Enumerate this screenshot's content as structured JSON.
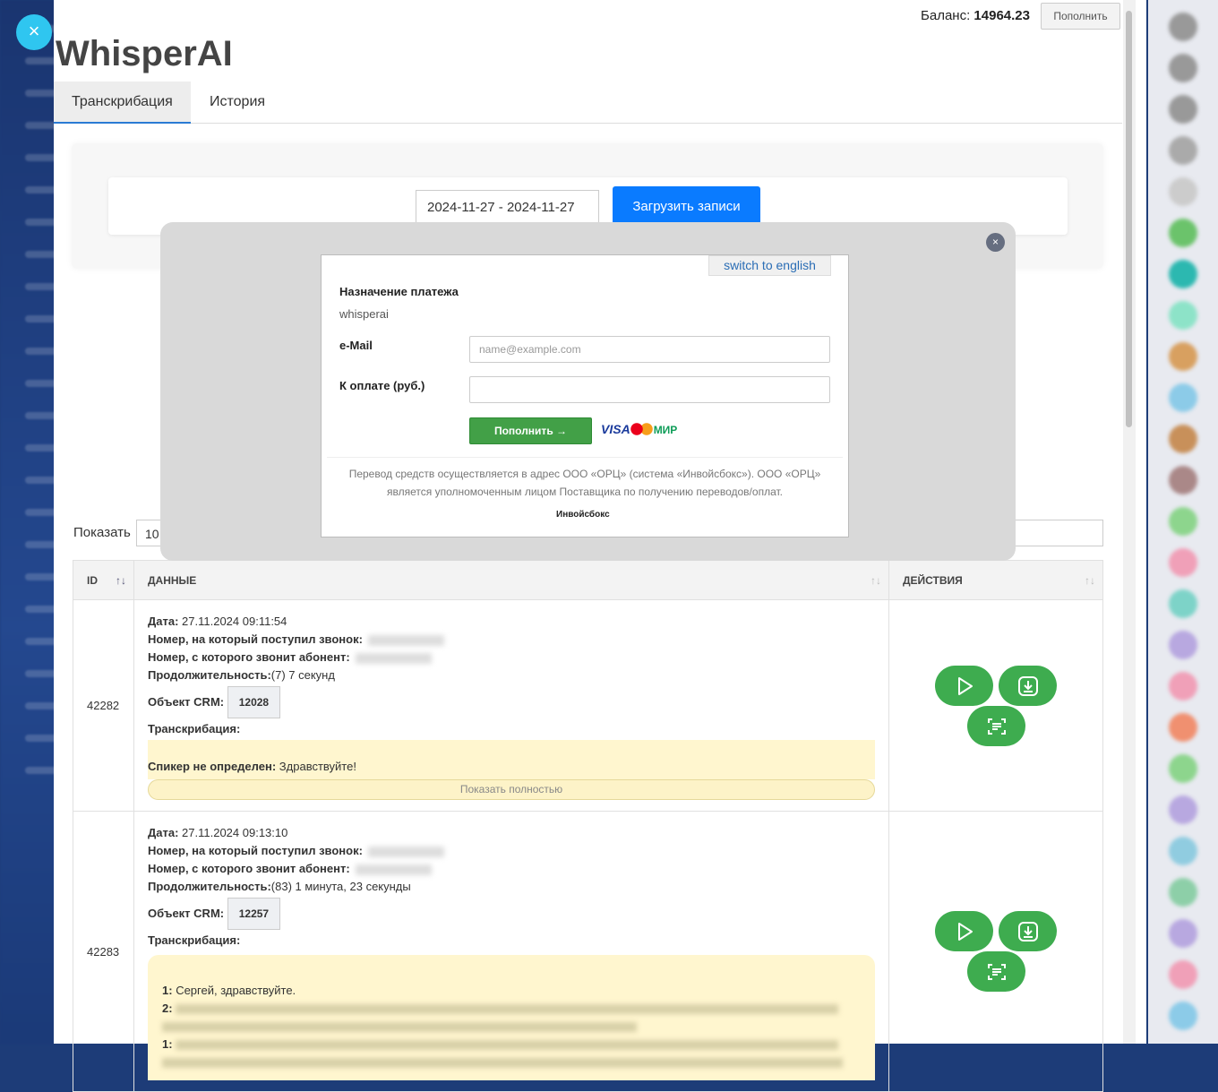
{
  "app": {
    "title": "WhisperAI",
    "close": "×"
  },
  "header": {
    "balance_label": "Баланс:",
    "balance_value": "14964.23",
    "topup_label": "Пополнить"
  },
  "tabs": [
    {
      "label": "Транскрибация",
      "active": true
    },
    {
      "label": "История",
      "active": false
    }
  ],
  "filter": {
    "date_range": "2024-11-27 - 2024-11-27",
    "load_label": "Загрузить записи"
  },
  "table_controls": {
    "show_label": "Показать",
    "show_value": "10"
  },
  "table": {
    "headers": [
      "ID",
      "ДАННЫЕ",
      "ДЕЙСТВИЯ"
    ],
    "sort_icon": "↑↓",
    "labels": {
      "date": "Дата:",
      "to_number": "Номер, на который поступил звонок:",
      "from_number": "Номер, с которого звонит абонент:",
      "duration": "Продолжительность:",
      "crm": "Объект CRM:",
      "transcription": "Транскрибация:",
      "show_full": "Показать полностью"
    },
    "rows": [
      {
        "id": "42282",
        "date": "27.11.2024 09:11:54",
        "duration": "(7) 7 секунд",
        "crm": "12028",
        "speaker": "Спикер не определен:",
        "text": "Здравствуйте!"
      },
      {
        "id": "42283",
        "date": "27.11.2024 09:13:10",
        "duration": "(83) 1 минута, 23 секунды",
        "crm": "12257",
        "lines": [
          {
            "speaker": "1:",
            "text": "Сергей, здравствуйте."
          },
          {
            "speaker": "2:",
            "text": ""
          },
          {
            "speaker": "1:",
            "text": ""
          }
        ]
      }
    ]
  },
  "payment": {
    "switch_label": "switch to english",
    "purpose_label": "Назначение платежа",
    "purpose_value": "whisperai",
    "email_label": "e-Mail",
    "email_placeholder": "name@example.com",
    "amount_label": "К оплате (руб.)",
    "pay_label": "Пополнить →",
    "cards": {
      "visa": "VISA",
      "mir": "МИР"
    },
    "footer": "Перевод средств осуществляется в адрес ООО «ОРЦ» (система «Инвойсбокс»). ООО «ОРЦ» является уполномоченным лицом Поставщика по получению переводов/оплат.",
    "brand": "Инвойсбокс",
    "close": "×"
  },
  "colors": {
    "primary": "#0a7bff",
    "success": "#3eac4f",
    "highlight": "#fff6cf"
  }
}
